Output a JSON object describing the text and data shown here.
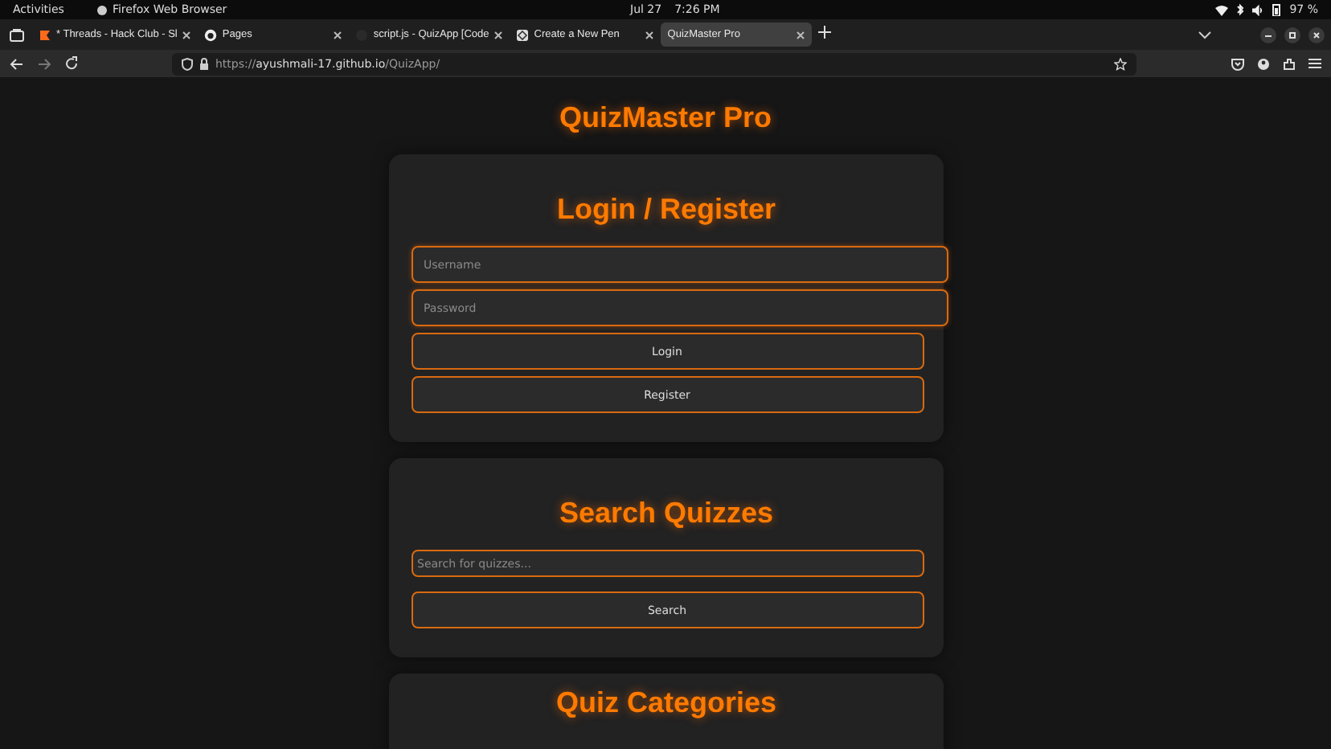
{
  "system_bar": {
    "activities": "Activities",
    "app": "Firefox Web Browser",
    "date": "Jul 27",
    "time": "7:26 PM",
    "battery": "97 %"
  },
  "tabs": [
    {
      "title": "* Threads - Hack Club - Sl",
      "selected": false
    },
    {
      "title": "Pages",
      "selected": false
    },
    {
      "title": "script.js - QuizApp [Code",
      "selected": false
    },
    {
      "title": "Create a New Pen",
      "selected": false
    },
    {
      "title": "QuizMaster Pro",
      "selected": true
    }
  ],
  "address_bar": {
    "scheme": "https://",
    "host": "ayushmali-17.github.io",
    "path": "/QuizApp/"
  },
  "page": {
    "title": "QuizMaster Pro",
    "sections": [
      {
        "heading": "Login / Register",
        "fields": [
          {
            "kind": "text",
            "placeholder": "Username"
          },
          {
            "kind": "password",
            "placeholder": "Password"
          }
        ],
        "buttons": [
          "Login",
          "Register"
        ]
      },
      {
        "heading": "Search Quizzes",
        "fields": [
          {
            "kind": "search",
            "placeholder": "Search for quizzes..."
          }
        ],
        "buttons": [
          "Search"
        ]
      },
      {
        "heading": "Quiz Categories"
      }
    ]
  }
}
